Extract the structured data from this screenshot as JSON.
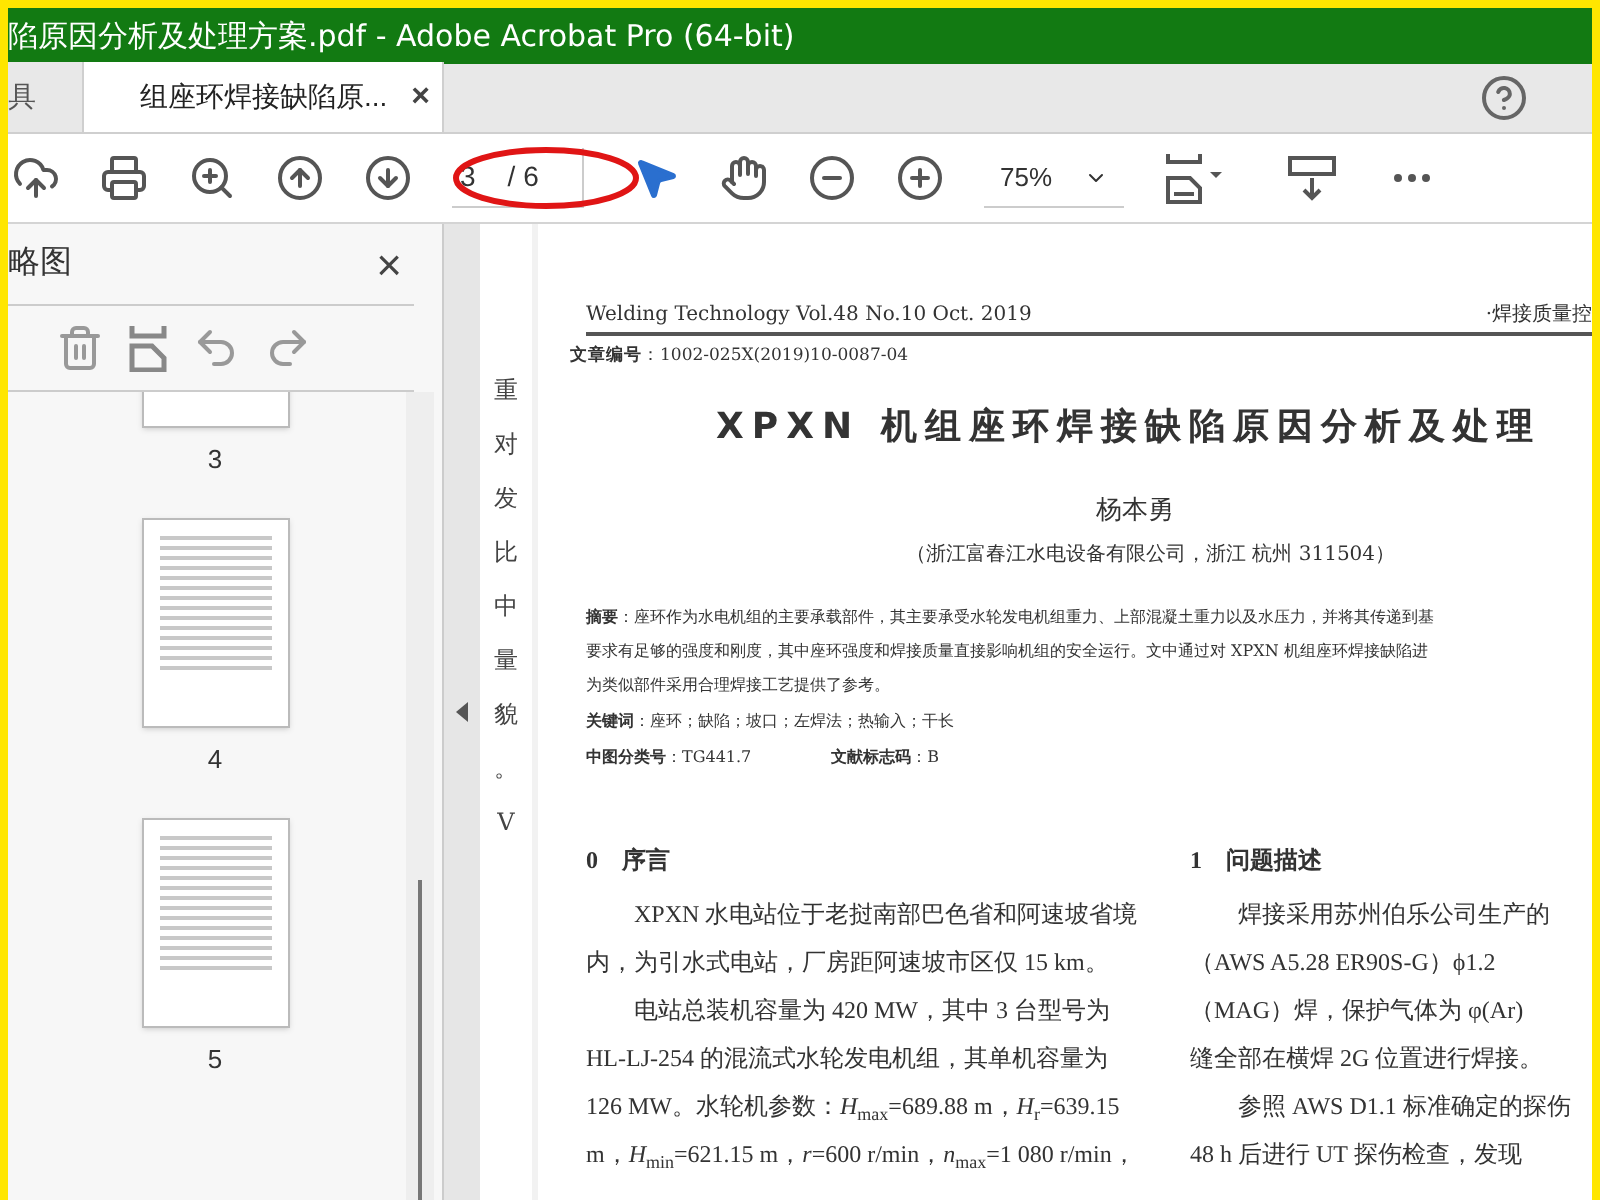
{
  "window": {
    "title": "陷原因分析及处理方案.pdf - Adobe Acrobat Pro (64-bit)"
  },
  "tabs": [
    {
      "label": "具",
      "selected": false
    },
    {
      "label": "组座环焊接缺陷原...",
      "selected": true,
      "close": "×"
    }
  ],
  "toolbar": {
    "page_current": "3",
    "page_total": "/ 6",
    "zoom": "75%"
  },
  "sidebar": {
    "title": "略图",
    "close": "×",
    "thumbnails": [
      {
        "page": "3",
        "selected": false
      },
      {
        "page": "4",
        "selected": false
      },
      {
        "page": "5",
        "selected": false
      }
    ]
  },
  "previous_page_fragments": [
    "重",
    "对",
    "发",
    "比",
    "中",
    "量",
    "貌",
    "。",
    "V"
  ],
  "document": {
    "journal": "Welding Technology  Vol.48  No.10  Oct. 2019",
    "section": "·焊接质量控",
    "article_no": "**文章编号**：1002-025X(2019)10-0087-04",
    "title": "XPXN 机组座环焊接缺陷原因分析及处理",
    "author": "杨本勇",
    "affiliation": "（浙江富春江水电设备有限公司，浙江  杭州  311504）",
    "abstract": [
      "**摘要**：座环作为水电机组的主要承载部件，其主要承受水轮发电机组重力、上部混凝土重力以及水压力，并将其传递到基",
      "要求有足够的强度和刚度，其中座环强度和焊接质量直接影响机组的安全运行。文中通过对 XPXN 机组座环焊接缺陷进",
      "为类似部件采用合理焊接工艺提供了参考。",
      "**关键词**：座环；缺陷；坡口；左焊法；热输入；干长"
    ],
    "classification": "**中图分类号**：TG441.7",
    "doc_code": "**文献标志码**：B",
    "columns": [
      {
        "heading": "0　序言",
        "paragraphs": [
          "XPXN 水电站位于老挝南部巴色省和阿速坡省境",
          "内，为引水式电站，厂房距阿速坡市区仅 15 km。",
          "电站总装机容量为 420 MW，其中 3 台型号为",
          "HL-LJ-254 的混流式水轮发电机组，其单机容量为",
          "126 MW。水轮机参数：*H*$_{max}$=689.88 m，*H*$_{r}$=639.15",
          "m，*H*$_{min}$=621.15 m，*r*=600 r/min，*n*$_{max}$=1 080 r/min，"
        ]
      },
      {
        "heading": "1　问题描述",
        "paragraphs": [
          "焊接采用苏州伯乐公司生产的",
          "（AWS A5.28 ER90S-G）ϕ1.2",
          "（MAG）焊，保护气体为 φ(Ar)",
          "缝全部在横焊 2G 位置进行焊接。",
          "参照 AWS D1.1 标准确定的探伤",
          "48 h 后进行 UT 探伤检查，发现"
        ]
      }
    ]
  }
}
